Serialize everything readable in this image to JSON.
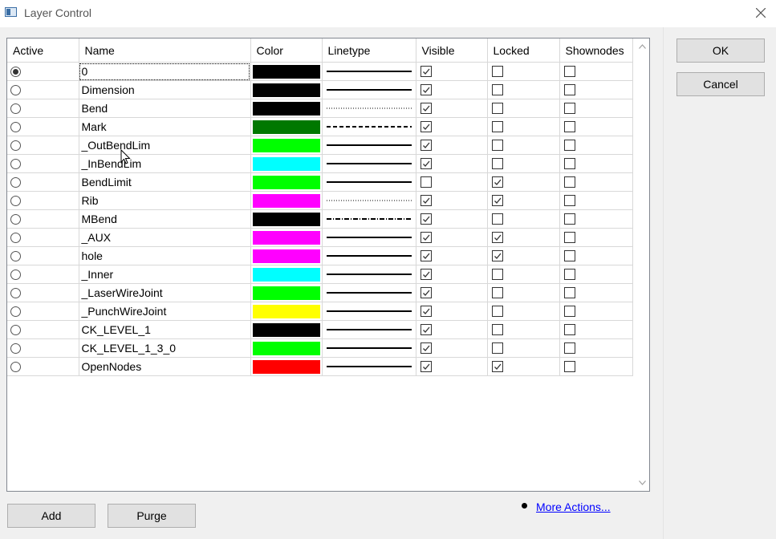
{
  "window": {
    "title": "Layer Control"
  },
  "columns": [
    "Active",
    "Name",
    "Color",
    "Linetype",
    "Visible",
    "Locked",
    "Shownodes"
  ],
  "layers": [
    {
      "active": true,
      "name": "0",
      "color": "#000000",
      "linetype": "solid",
      "visible": true,
      "locked": false,
      "shownodes": false
    },
    {
      "active": false,
      "name": "Dimension",
      "color": "#000000",
      "linetype": "solid",
      "visible": true,
      "locked": false,
      "shownodes": false
    },
    {
      "active": false,
      "name": "Bend",
      "color": "#000000",
      "linetype": "dotted",
      "visible": true,
      "locked": false,
      "shownodes": false
    },
    {
      "active": false,
      "name": "Mark",
      "color": "#007800",
      "linetype": "dashed",
      "visible": true,
      "locked": false,
      "shownodes": false
    },
    {
      "active": false,
      "name": "_OutBendLim",
      "color": "#00ff00",
      "linetype": "solid",
      "visible": true,
      "locked": false,
      "shownodes": false
    },
    {
      "active": false,
      "name": "_InBendLim",
      "color": "#00ffff",
      "linetype": "solid",
      "visible": true,
      "locked": false,
      "shownodes": false
    },
    {
      "active": false,
      "name": "BendLimit",
      "color": "#00ff00",
      "linetype": "solid",
      "visible": false,
      "locked": true,
      "shownodes": false
    },
    {
      "active": false,
      "name": "Rib",
      "color": "#ff00ff",
      "linetype": "dotted",
      "visible": true,
      "locked": true,
      "shownodes": false
    },
    {
      "active": false,
      "name": "MBend",
      "color": "#000000",
      "linetype": "dashdot",
      "visible": true,
      "locked": false,
      "shownodes": false
    },
    {
      "active": false,
      "name": "_AUX",
      "color": "#ff00ff",
      "linetype": "solid",
      "visible": true,
      "locked": true,
      "shownodes": false
    },
    {
      "active": false,
      "name": "hole",
      "color": "#ff00ff",
      "linetype": "solid",
      "visible": true,
      "locked": true,
      "shownodes": false
    },
    {
      "active": false,
      "name": "_Inner",
      "color": "#00ffff",
      "linetype": "solid",
      "visible": true,
      "locked": false,
      "shownodes": false
    },
    {
      "active": false,
      "name": "_LaserWireJoint",
      "color": "#00ff00",
      "linetype": "solid",
      "visible": true,
      "locked": false,
      "shownodes": false
    },
    {
      "active": false,
      "name": "_PunchWireJoint",
      "color": "#ffff00",
      "linetype": "solid",
      "visible": true,
      "locked": false,
      "shownodes": false
    },
    {
      "active": false,
      "name": "CK_LEVEL_1",
      "color": "#000000",
      "linetype": "solid",
      "visible": true,
      "locked": false,
      "shownodes": false
    },
    {
      "active": false,
      "name": "CK_LEVEL_1_3_0",
      "color": "#00ff00",
      "linetype": "solid",
      "visible": true,
      "locked": false,
      "shownodes": false
    },
    {
      "active": false,
      "name": "OpenNodes",
      "color": "#ff0000",
      "linetype": "solid",
      "visible": true,
      "locked": true,
      "shownodes": false
    }
  ],
  "buttons": {
    "ok": "OK",
    "cancel": "Cancel",
    "add": "Add",
    "purge": "Purge"
  },
  "more_actions": "More Actions..."
}
